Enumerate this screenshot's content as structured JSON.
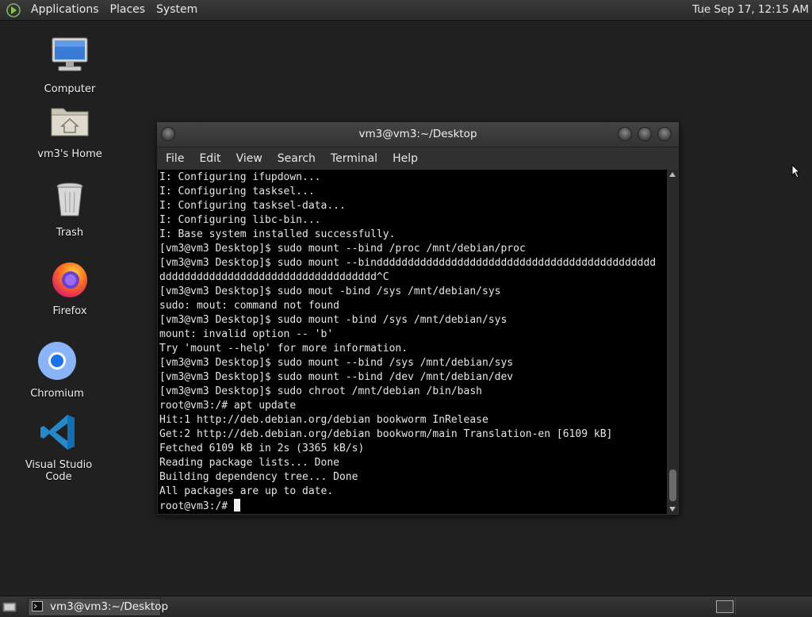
{
  "top_panel": {
    "menus": [
      "Applications",
      "Places",
      "System"
    ],
    "clock": "Tue Sep 17, 12:15 AM"
  },
  "desktop_icons": [
    {
      "label": "Computer",
      "icon": "computer-icon"
    },
    {
      "label": "vm3's Home",
      "icon": "home-folder-icon"
    },
    {
      "label": "Trash",
      "icon": "trash-icon"
    },
    {
      "label": "Firefox",
      "icon": "firefox-icon"
    },
    {
      "label": "Chromium",
      "icon": "chromium-icon"
    },
    {
      "label": "Visual Studio Code",
      "icon": "vscode-icon"
    }
  ],
  "terminal": {
    "title": "vm3@vm3:~/Desktop",
    "menus": [
      "File",
      "Edit",
      "View",
      "Search",
      "Terminal",
      "Help"
    ],
    "lines": [
      "I: Configuring ifupdown...",
      "I: Configuring tasksel...",
      "I: Configuring tasksel-data...",
      "I: Configuring libc-bin...",
      "I: Base system installed successfully.",
      "[vm3@vm3 Desktop]$ sudo mount --bind /proc /mnt/debian/proc",
      "[vm3@vm3 Desktop]$ sudo mount --binddddddddddddddddddddddddddddddddddddddddddddd",
      "ddddddddddddddddddddddddddddddddddd^C",
      "[vm3@vm3 Desktop]$ sudo mout -bind /sys /mnt/debian/sys",
      "sudo: mout: command not found",
      "[vm3@vm3 Desktop]$ sudo mount -bind /sys /mnt/debian/sys",
      "mount: invalid option -- 'b'",
      "Try 'mount --help' for more information.",
      "[vm3@vm3 Desktop]$ sudo mount --bind /sys /mnt/debian/sys",
      "[vm3@vm3 Desktop]$ sudo mount --bind /dev /mnt/debian/dev",
      "[vm3@vm3 Desktop]$ sudo chroot /mnt/debian /bin/bash",
      "root@vm3:/# apt update",
      "Hit:1 http://deb.debian.org/debian bookworm InRelease",
      "Get:2 http://deb.debian.org/debian bookworm/main Translation-en [6109 kB]",
      "Fetched 6109 kB in 2s (3365 kB/s)",
      "Reading package lists... Done",
      "Building dependency tree... Done",
      "All packages are up to date."
    ],
    "prompt": "root@vm3:/# "
  },
  "taskbar": {
    "task_label": "vm3@vm3:~/Desktop"
  }
}
